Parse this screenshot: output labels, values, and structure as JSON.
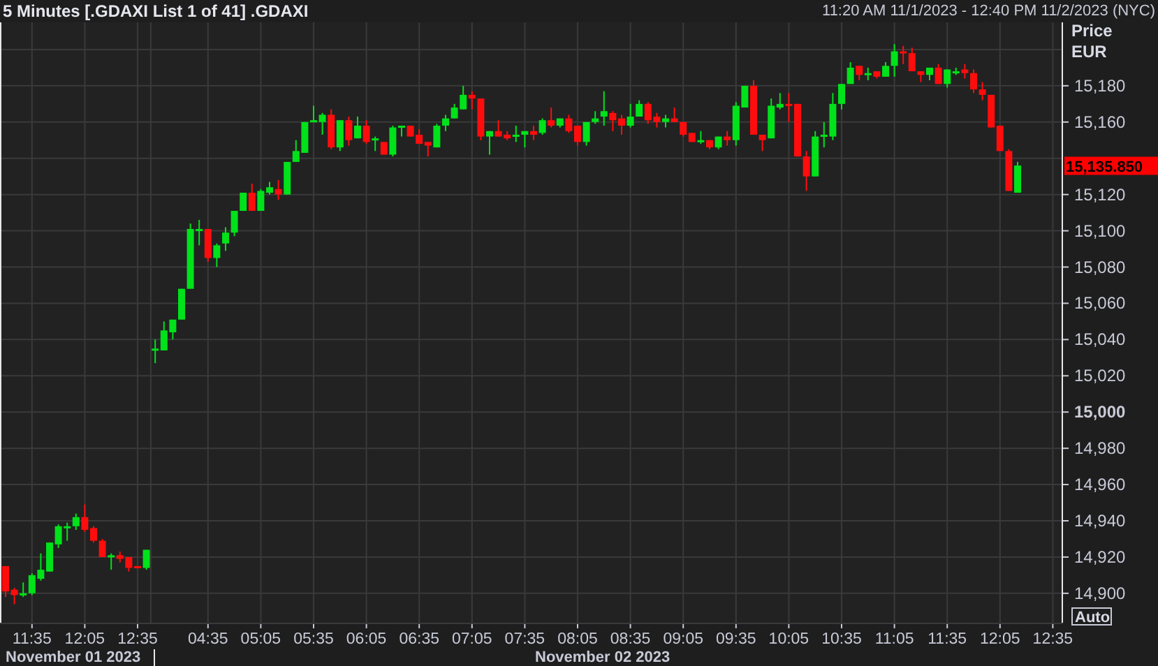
{
  "header": {
    "title": "5 Minutes [.GDAXI List 1 of 41] .GDAXI",
    "range": "11:20 AM 11/1/2023 - 12:40 PM 11/2/2023 (NYC)"
  },
  "chart": {
    "axis_title": "Price",
    "currency": "EUR",
    "last_price": "15,135.850",
    "scale_button": "Auto",
    "dates": [
      "November 01 2023",
      "November 02 2023"
    ],
    "chart_data": {
      "type": "candlestick",
      "grid": true,
      "ylim": [
        14883,
        15215
      ],
      "yticks": [
        {
          "value": 14900,
          "label": "14,900"
        },
        {
          "value": 14920,
          "label": "14,920"
        },
        {
          "value": 14940,
          "label": "14,940"
        },
        {
          "value": 14960,
          "label": "14,960"
        },
        {
          "value": 14980,
          "label": "14,980"
        },
        {
          "value": 15000,
          "label": "15,000"
        },
        {
          "value": 15020,
          "label": "15,020"
        },
        {
          "value": 15040,
          "label": "15,040"
        },
        {
          "value": 15060,
          "label": "15,060"
        },
        {
          "value": 15080,
          "label": "15,080"
        },
        {
          "value": 15100,
          "label": "15,100"
        },
        {
          "value": 15120,
          "label": "15,120"
        },
        {
          "value": 15160,
          "label": "15,160"
        },
        {
          "value": 15180,
          "label": "15,180"
        }
      ],
      "categories": [
        null,
        null,
        null,
        "11:35",
        null,
        null,
        null,
        null,
        null,
        "12:05",
        null,
        null,
        null,
        null,
        null,
        "12:35",
        null,
        null,
        null,
        null,
        null,
        null,
        null,
        "04:35",
        null,
        null,
        null,
        null,
        null,
        "05:05",
        null,
        null,
        null,
        null,
        null,
        "05:35",
        null,
        null,
        null,
        null,
        null,
        "06:05",
        null,
        null,
        null,
        null,
        null,
        "06:35",
        null,
        null,
        null,
        null,
        null,
        "07:05",
        null,
        null,
        null,
        null,
        null,
        "07:35",
        null,
        null,
        null,
        null,
        null,
        "08:05",
        null,
        null,
        null,
        null,
        null,
        "08:35",
        null,
        null,
        null,
        null,
        null,
        "09:05",
        null,
        null,
        null,
        null,
        null,
        "09:35",
        null,
        null,
        null,
        null,
        null,
        "10:05",
        null,
        null,
        null,
        null,
        null,
        "10:35",
        null,
        null,
        null,
        null,
        null,
        "11:05",
        null,
        null,
        null,
        null,
        null,
        "11:35",
        null,
        null,
        null,
        null,
        null,
        "12:05",
        null,
        null,
        null,
        null,
        null,
        "12:35"
      ],
      "ohlc": [
        [
          14915,
          14915,
          14898,
          14901
        ],
        [
          14902,
          14903,
          14894,
          14899
        ],
        [
          14899,
          14906,
          14898,
          14900
        ],
        [
          14900,
          14911,
          14899,
          14910
        ],
        [
          14908,
          14922,
          14907,
          14913
        ],
        [
          14912,
          14928,
          14912,
          14928
        ],
        [
          14927,
          14938,
          14925,
          14937
        ],
        [
          14936,
          14939,
          14929,
          14937
        ],
        [
          14937,
          14944,
          14935,
          14942
        ],
        [
          14942,
          14949,
          14934,
          14935
        ],
        [
          14936,
          14937,
          14928,
          14929
        ],
        [
          14929,
          14930,
          14920,
          14920
        ],
        [
          14920,
          14922,
          14913,
          14921
        ],
        [
          14921,
          14923,
          14917,
          14919
        ],
        [
          14920,
          14920,
          14912,
          14914
        ],
        [
          14915,
          14915,
          14914,
          14914
        ],
        [
          14914,
          14924,
          14913,
          14924
        ],
        [
          15034,
          15040,
          15027,
          15035
        ],
        [
          15034,
          15050,
          15034,
          15045
        ],
        [
          15044,
          15051,
          15040,
          15051
        ],
        [
          15051,
          15068,
          15051,
          15068
        ],
        [
          15068,
          15104,
          15068,
          15101
        ],
        [
          15100,
          15106,
          15092,
          15101
        ],
        [
          15101,
          15101,
          15083,
          15085
        ],
        [
          15085,
          15093,
          15080,
          15092
        ],
        [
          15093,
          15102,
          15089,
          15099
        ],
        [
          15099,
          15111,
          15097,
          15111
        ],
        [
          15111,
          15121,
          15111,
          15121
        ],
        [
          15121,
          15126,
          15111,
          15111
        ],
        [
          15111,
          15123,
          15111,
          15122
        ],
        [
          15121,
          15127,
          15120,
          15124
        ],
        [
          15123,
          15128,
          15117,
          15120
        ],
        [
          15120,
          15138,
          15120,
          15138
        ],
        [
          15138,
          15150,
          15138,
          15144
        ],
        [
          15143,
          15160,
          15143,
          15160
        ],
        [
          15160,
          15169,
          15160,
          15161
        ],
        [
          15160,
          15165,
          15153,
          15164
        ],
        [
          15164,
          15167,
          15145,
          15146
        ],
        [
          15146,
          15161,
          15144,
          15161
        ],
        [
          15161,
          15163,
          15147,
          15150
        ],
        [
          15151,
          15163,
          15151,
          15158
        ],
        [
          15158,
          15161,
          15148,
          15149
        ],
        [
          15150,
          15152,
          15144,
          15151
        ],
        [
          15149,
          15149,
          15142,
          15142
        ],
        [
          15142,
          15158,
          15141,
          15157
        ],
        [
          15157,
          15158,
          15152,
          15158
        ],
        [
          15158,
          15158,
          15152,
          15152
        ],
        [
          15153,
          15156,
          15148,
          15148
        ],
        [
          15149,
          15149,
          15141,
          15147
        ],
        [
          15146,
          15159,
          15146,
          15158
        ],
        [
          15158,
          15164,
          15155,
          15162
        ],
        [
          15162,
          15170,
          15162,
          15168
        ],
        [
          15167,
          15180,
          15167,
          15175
        ],
        [
          15175,
          15177,
          15167,
          15173
        ],
        [
          15173,
          15173,
          15150,
          15152
        ],
        [
          15152,
          15155,
          15142,
          15155
        ],
        [
          15155,
          15161,
          15152,
          15152
        ],
        [
          15153,
          15155,
          15150,
          15151
        ],
        [
          15152,
          15158,
          15149,
          15153
        ],
        [
          15153,
          15155,
          15146,
          15155
        ],
        [
          15155,
          15158,
          15150,
          15153
        ],
        [
          15154,
          15162,
          15153,
          15161
        ],
        [
          15161,
          15168,
          15157,
          15158
        ],
        [
          15158,
          15162,
          15157,
          15162
        ],
        [
          15162,
          15164,
          15154,
          15155
        ],
        [
          15158,
          15158,
          15147,
          15149
        ],
        [
          15149,
          15160,
          15147,
          15160
        ],
        [
          15160,
          15166,
          15159,
          15162
        ],
        [
          15163,
          15177,
          15158,
          15166
        ],
        [
          15165,
          15166,
          15155,
          15161
        ],
        [
          15162,
          15164,
          15153,
          15158
        ],
        [
          15158,
          15170,
          15157,
          15163
        ],
        [
          15163,
          15172,
          15163,
          15170
        ],
        [
          15170,
          15171,
          15159,
          15161
        ],
        [
          15163,
          15165,
          15157,
          15160
        ],
        [
          15160,
          15164,
          15157,
          15162
        ],
        [
          15162,
          15168,
          15160,
          15160
        ],
        [
          15160,
          15160,
          15152,
          15153
        ],
        [
          15154,
          15154,
          15149,
          15149
        ],
        [
          15149,
          15155,
          15148,
          15150
        ],
        [
          15150,
          15150,
          15145,
          15146
        ],
        [
          15146,
          15152,
          15145,
          15152
        ],
        [
          15152,
          15155,
          15147,
          15150
        ],
        [
          15150,
          15171,
          15147,
          15169
        ],
        [
          15168,
          15180,
          15168,
          15180
        ],
        [
          15180,
          15183,
          15153,
          15153
        ],
        [
          15153,
          15153,
          15144,
          15150
        ],
        [
          15151,
          15173,
          15151,
          15169
        ],
        [
          15168,
          15176,
          15167,
          15170
        ],
        [
          15170,
          15176,
          15160,
          15169
        ],
        [
          15170,
          15170,
          15141,
          15141
        ],
        [
          15141,
          15144,
          15122,
          15130
        ],
        [
          15130,
          15155,
          15130,
          15152
        ],
        [
          15152,
          15160,
          15146,
          15153
        ],
        [
          15152,
          15176,
          15150,
          15170
        ],
        [
          15170,
          15181,
          15167,
          15181
        ],
        [
          15181,
          15193,
          15181,
          15190
        ],
        [
          15191,
          15191,
          15183,
          15186
        ],
        [
          15186,
          15190,
          15183,
          15187
        ],
        [
          15188,
          15188,
          15184,
          15185
        ],
        [
          15185,
          15193,
          15185,
          15191
        ],
        [
          15191,
          15203,
          15185,
          15199
        ],
        [
          15199,
          15202,
          15192,
          15198
        ],
        [
          15198,
          15201,
          15188,
          15188
        ],
        [
          15188,
          15188,
          15182,
          15186
        ],
        [
          15186,
          15190,
          15183,
          15190
        ],
        [
          15190,
          15192,
          15181,
          15181
        ],
        [
          15181,
          15189,
          15179,
          15189
        ],
        [
          15187,
          15190,
          15186,
          15188
        ],
        [
          15189,
          15192,
          15184,
          15187
        ],
        [
          15187,
          15189,
          15176,
          15178
        ],
        [
          15178,
          15182,
          15172,
          15175
        ],
        [
          15175,
          15175,
          15157,
          15157
        ],
        [
          15158,
          15158,
          15144,
          15144
        ],
        [
          15144,
          15145,
          15122,
          15122
        ],
        [
          15121,
          15138,
          15121,
          15136
        ],
        null,
        null,
        null,
        null
      ]
    }
  }
}
